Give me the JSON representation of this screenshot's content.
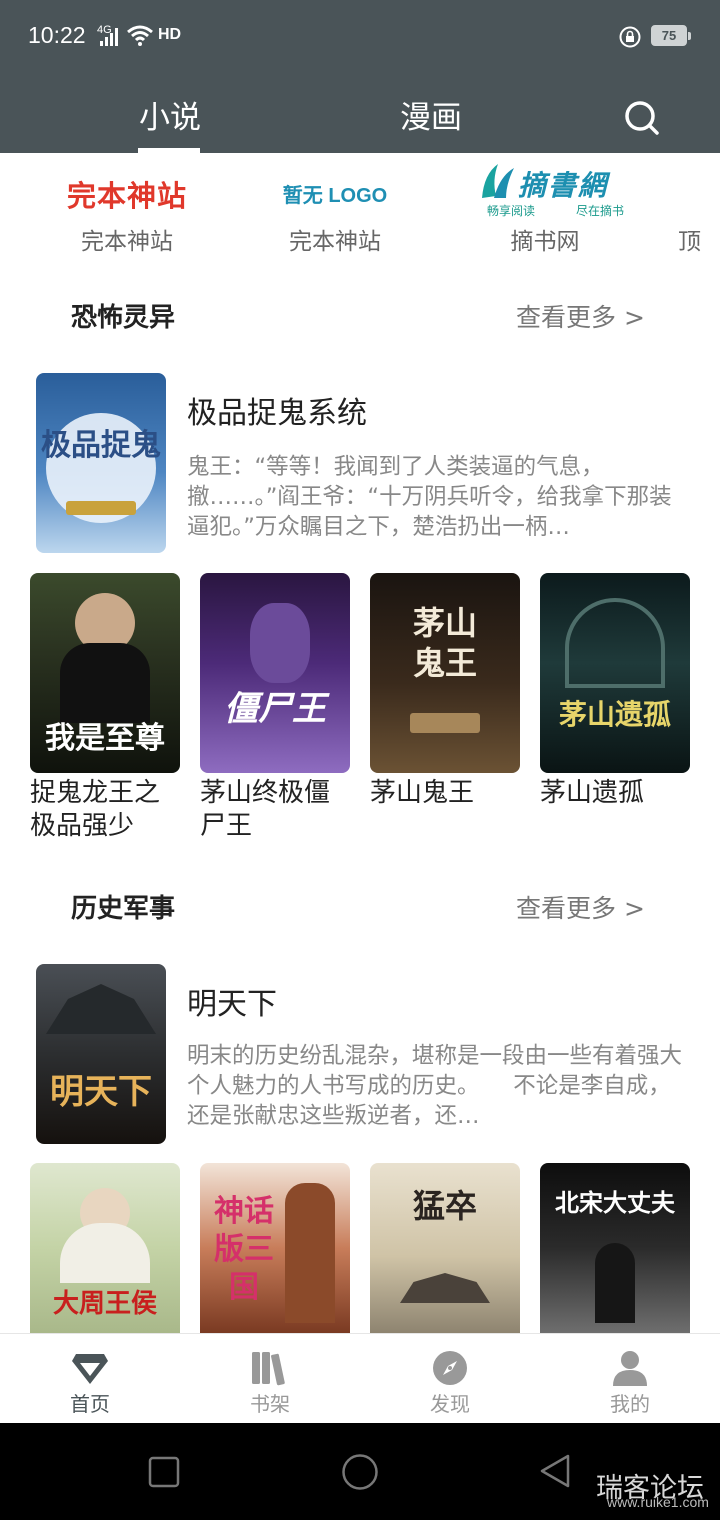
{
  "status_bar": {
    "time": "10:22",
    "network": "4G",
    "hd": "HD",
    "battery": "75"
  },
  "header": {
    "tabs": [
      {
        "label": "小说",
        "active": true
      },
      {
        "label": "漫画",
        "active": false
      }
    ],
    "search_icon": "search-icon",
    "background_color": "#4a5458"
  },
  "sites": [
    {
      "logo_text": "完本神站",
      "label": "完本神站"
    },
    {
      "logo_text": "暂无 LOGO",
      "label": "完本神站"
    },
    {
      "logo_text": "摘書網",
      "logo_sub_left": "畅享阅读",
      "logo_sub_right": "尽在摘书",
      "label": "摘书网"
    },
    {
      "label": "顶"
    }
  ],
  "sections": [
    {
      "title": "恐怖灵异",
      "more": "查看更多 >",
      "featured": {
        "title": "极品捉鬼系统",
        "description": "鬼王：“等等！我闻到了人类装逼的气息，撤……。”阎王爷：“十万阴兵听令，给我拿下那装逼犯。”万众瞩目之下，楚浩扔出一柄…",
        "cover_text": "极品捉鬼"
      },
      "books": [
        {
          "title": "捉鬼龙王之极品强少",
          "cover_text": "我是至尊"
        },
        {
          "title": "茅山终极僵尸王",
          "cover_text": "僵尸王"
        },
        {
          "title": "茅山鬼王",
          "cover_text": "茅山鬼王"
        },
        {
          "title": "茅山遗孤",
          "cover_text": "茅山遗孤"
        }
      ]
    },
    {
      "title": "历史军事",
      "more": "查看更多 >",
      "featured": {
        "title": "明天下",
        "description": "明末的历史纷乱混杂，堪称是一段由一些有着强大个人魅力的人书写成的历史。　　不论是李自成，还是张献忠这些叛逆者，还…",
        "cover_text": "明天下"
      },
      "books": [
        {
          "title": "",
          "cover_text": "大周王侯"
        },
        {
          "title": "",
          "cover_text": "神话版三国"
        },
        {
          "title": "",
          "cover_text": "猛卒"
        },
        {
          "title": "",
          "cover_text": "北宋大丈夫"
        }
      ]
    }
  ],
  "bottom_nav": [
    {
      "label": "首页",
      "icon": "home-diamond-icon",
      "active": true
    },
    {
      "label": "书架",
      "icon": "bookshelf-icon",
      "active": false
    },
    {
      "label": "发现",
      "icon": "compass-icon",
      "active": false
    },
    {
      "label": "我的",
      "icon": "profile-icon",
      "active": false
    }
  ],
  "watermark": {
    "text": "瑞客论坛",
    "url": "www.ruike1.com"
  }
}
